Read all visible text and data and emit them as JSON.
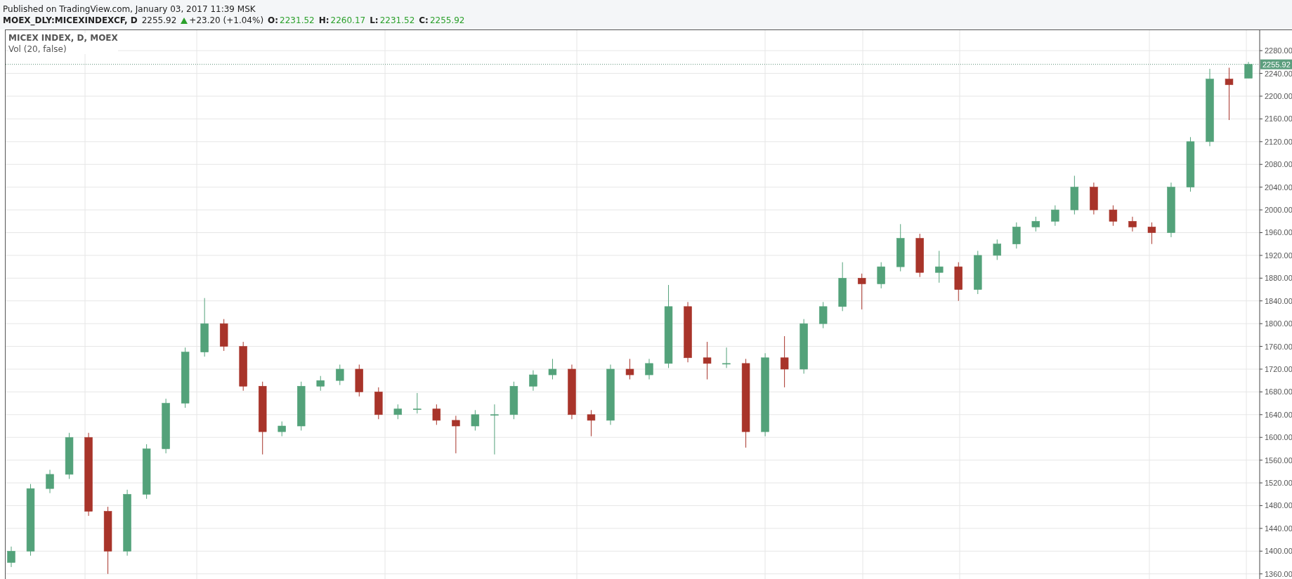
{
  "header": {
    "published": "Published on TradingView.com, January 03, 2017 11:39 MSK",
    "symbol": "MOEX_DLY:MICEXINDEXCF, D",
    "price": "2255.92",
    "change_up": true,
    "change": "+23.20 (+1.04%)",
    "ohlc": [
      {
        "label": "O:",
        "value": "2231.52"
      },
      {
        "label": "H:",
        "value": "2260.17"
      },
      {
        "label": "L:",
        "value": "2231.52"
      },
      {
        "label": "C:",
        "value": "2255.92"
      }
    ]
  },
  "chart": {
    "legend": "MICEX INDEX, D, MOEX",
    "indicator": "Vol (20, false)",
    "chart_data": {
      "type": "candlestick",
      "grid": true,
      "ylim": [
        1351,
        2316
      ],
      "yticks": [
        {
          "value": 1360,
          "label": "1360.00"
        },
        {
          "value": 1400,
          "label": "1400.00"
        },
        {
          "value": 1440,
          "label": "1440.00"
        },
        {
          "value": 1480,
          "label": "1480.00"
        },
        {
          "value": 1520,
          "label": "1520.00"
        },
        {
          "value": 1560,
          "label": "1560.00"
        },
        {
          "value": 1600,
          "label": "1600.00"
        },
        {
          "value": 1640,
          "label": "1640.00"
        },
        {
          "value": 1680,
          "label": "1680.00"
        },
        {
          "value": 1720,
          "label": "1720.00"
        },
        {
          "value": 1760,
          "label": "1760.00"
        },
        {
          "value": 1800,
          "label": "1800.00"
        },
        {
          "value": 1840,
          "label": "1840.00"
        },
        {
          "value": 1880,
          "label": "1880.00"
        },
        {
          "value": 1920,
          "label": "1920.00"
        },
        {
          "value": 1960,
          "label": "1960.00"
        },
        {
          "value": 2000,
          "label": "2000.00"
        },
        {
          "value": 2040,
          "label": "2040.00"
        },
        {
          "value": 2080,
          "label": "2080.00"
        },
        {
          "value": 2120,
          "label": "2120.00"
        },
        {
          "value": 2160,
          "label": "2160.00"
        },
        {
          "value": 2200,
          "label": "2200.00"
        },
        {
          "value": 2240,
          "label": "2240.00"
        },
        {
          "value": 2280,
          "label": "2280.00"
        }
      ],
      "ref_lines": [
        {
          "axis": "y",
          "value": 2255.92,
          "label": "2255.92"
        }
      ],
      "ohlc": [
        [
          1380,
          1408,
          1372,
          1400
        ],
        [
          1400,
          1518,
          1392,
          1510
        ],
        [
          1510,
          1543,
          1502,
          1535
        ],
        [
          1535,
          1608,
          1527,
          1600
        ],
        [
          1600,
          1608,
          1462,
          1470
        ],
        [
          1470,
          1478,
          1360,
          1400
        ],
        [
          1400,
          1508,
          1392,
          1500
        ],
        [
          1500,
          1588,
          1492,
          1580
        ],
        [
          1580,
          1668,
          1572,
          1660
        ],
        [
          1660,
          1758,
          1652,
          1750
        ],
        [
          1750,
          1845,
          1742,
          1800
        ],
        [
          1800,
          1808,
          1752,
          1760
        ],
        [
          1760,
          1768,
          1682,
          1690
        ],
        [
          1690,
          1698,
          1570,
          1610
        ],
        [
          1610,
          1628,
          1602,
          1620
        ],
        [
          1620,
          1698,
          1612,
          1690
        ],
        [
          1690,
          1708,
          1682,
          1700
        ],
        [
          1700,
          1728,
          1692,
          1720
        ],
        [
          1720,
          1728,
          1672,
          1680
        ],
        [
          1680,
          1688,
          1632,
          1640
        ],
        [
          1640,
          1658,
          1632,
          1650
        ],
        [
          1650,
          1678,
          1642,
          1650
        ],
        [
          1650,
          1658,
          1622,
          1630
        ],
        [
          1630,
          1638,
          1572,
          1620
        ],
        [
          1620,
          1648,
          1612,
          1640
        ],
        [
          1640,
          1658,
          1570,
          1640
        ],
        [
          1640,
          1698,
          1632,
          1690
        ],
        [
          1690,
          1718,
          1682,
          1710
        ],
        [
          1710,
          1738,
          1702,
          1720
        ],
        [
          1720,
          1728,
          1632,
          1640
        ],
        [
          1640,
          1648,
          1602,
          1630
        ],
        [
          1630,
          1728,
          1622,
          1720
        ],
        [
          1720,
          1738,
          1702,
          1710
        ],
        [
          1710,
          1738,
          1702,
          1730
        ],
        [
          1730,
          1868,
          1722,
          1830
        ],
        [
          1830,
          1838,
          1732,
          1740
        ],
        [
          1740,
          1768,
          1702,
          1730
        ],
        [
          1730,
          1758,
          1722,
          1730
        ],
        [
          1730,
          1738,
          1582,
          1610
        ],
        [
          1610,
          1748,
          1602,
          1740
        ],
        [
          1740,
          1778,
          1688,
          1720
        ],
        [
          1720,
          1808,
          1712,
          1800
        ],
        [
          1800,
          1838,
          1792,
          1830
        ],
        [
          1830,
          1908,
          1822,
          1880
        ],
        [
          1880,
          1888,
          1825,
          1870
        ],
        [
          1870,
          1908,
          1862,
          1900
        ],
        [
          1900,
          1975,
          1892,
          1950
        ],
        [
          1950,
          1958,
          1882,
          1890
        ],
        [
          1890,
          1928,
          1872,
          1900
        ],
        [
          1900,
          1908,
          1840,
          1860
        ],
        [
          1860,
          1928,
          1852,
          1920
        ],
        [
          1920,
          1948,
          1912,
          1940
        ],
        [
          1940,
          1978,
          1932,
          1970
        ],
        [
          1970,
          1988,
          1962,
          1980
        ],
        [
          1980,
          2008,
          1972,
          2000
        ],
        [
          2000,
          2060,
          1992,
          2040
        ],
        [
          2040,
          2048,
          1992,
          2000
        ],
        [
          2000,
          2008,
          1972,
          1980
        ],
        [
          1980,
          1988,
          1962,
          1970
        ],
        [
          1970,
          1978,
          1940,
          1960
        ],
        [
          1960,
          2048,
          1952,
          2040
        ],
        [
          2040,
          2128,
          2032,
          2120
        ],
        [
          2120,
          2248,
          2112,
          2230
        ],
        [
          2230,
          2250,
          2158,
          2220
        ],
        [
          2231.52,
          2260.17,
          2231.52,
          2255.92
        ]
      ]
    }
  }
}
